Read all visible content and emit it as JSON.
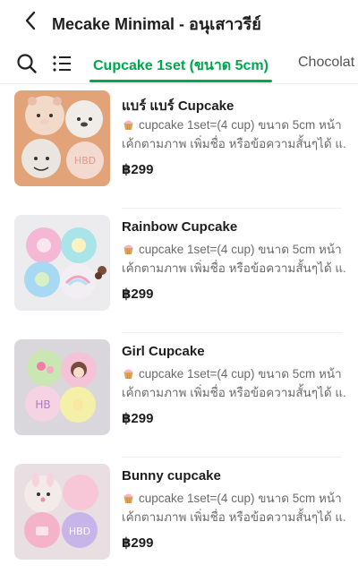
{
  "header": {
    "title": "Mecake Minimal - อนุเสาวรีย์",
    "back_icon": "chevron-left-icon"
  },
  "tabs": {
    "search_icon": "search-icon",
    "menu_icon": "list-menu-icon",
    "items": [
      {
        "label": "Cupcake 1set (ขนาด 5cm)",
        "active": true
      },
      {
        "label": "Chocolat",
        "active": false
      }
    ]
  },
  "colors": {
    "accent": "#00a650",
    "text_primary": "#1e1e1e",
    "text_secondary": "#6b6b6b"
  },
  "products": [
    {
      "name": "แบร์ แบร์ Cupcake",
      "desc_line1": "cupcake 1set=(4 cup) ขนาด 5cm หน้า",
      "desc_line2": "เค้กตามภาพ เพิ่มชื่อ หรือข้อความสั้นๆได้ แ...",
      "price": "฿299"
    },
    {
      "name": "Rainbow Cupcake",
      "desc_line1": "cupcake 1set=(4 cup) ขนาด 5cm หน้า",
      "desc_line2": "เค้กตามภาพ เพิ่มชื่อ หรือข้อความสั้นๆได้ แ...",
      "price": "฿299"
    },
    {
      "name": "Girl Cupcake",
      "desc_line1": "cupcake 1set=(4 cup) ขนาด 5cm หน้า",
      "desc_line2": "เค้กตามภาพ เพิ่มชื่อ หรือข้อความสั้นๆได้ แ...",
      "price": "฿299"
    },
    {
      "name": "Bunny cupcake",
      "desc_line1": "cupcake 1set=(4 cup) ขนาด 5cm หน้า",
      "desc_line2": "เค้กตามภาพ เพิ่มชื่อ หรือข้อความสั้นๆได้ แ...",
      "price": "฿299"
    }
  ]
}
